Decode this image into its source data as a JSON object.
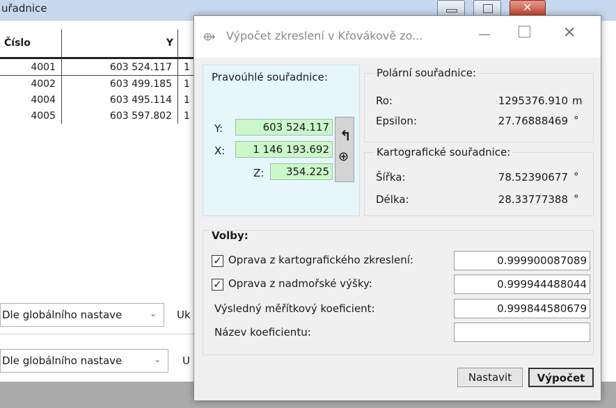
{
  "background_window": {
    "title": "uřadnice",
    "table": {
      "headers": [
        "Číslo",
        "Y",
        ""
      ],
      "rows": [
        [
          "4001",
          "603 524.117",
          "1"
        ],
        [
          "4002",
          "603 499.185",
          "1"
        ],
        [
          "4004",
          "603 495.114",
          "1"
        ],
        [
          "4005",
          "603 597.802",
          "1"
        ]
      ]
    },
    "combo1": {
      "value": "Dle globálního nastave",
      "side_label": "Uk"
    },
    "combo2": {
      "value": "Dle globálního nastave",
      "side_label": "U"
    }
  },
  "dialog": {
    "title": "Výpočet zkreslení v Křovákově zo...",
    "pravouhle": {
      "title": "Pravoúhlé souřadnice:",
      "y_label": "Y:",
      "y_value": "603 524.117",
      "x_label": "X:",
      "x_value": "1 146 193.692",
      "z_label": "Z:",
      "z_value": "354.225"
    },
    "polarni": {
      "title": "Polární souřadnice:",
      "ro_label": "Ro:",
      "ro_value": "1295376.910",
      "ro_unit": "m",
      "eps_label": "Epsilon:",
      "eps_value": "27.76888469",
      "eps_unit": "°"
    },
    "kartograficke": {
      "title": "Kartografické souřadnice:",
      "sirka_label": "Šířka:",
      "sirka_value": "78.52390677",
      "sirka_unit": "°",
      "delka_label": "Délka:",
      "delka_value": "28.33777388",
      "delka_unit": "°"
    },
    "volby": {
      "title": "Volby:",
      "opt1_label": "Oprava z kartografického zkreslení:",
      "opt1_checked": true,
      "opt1_value": "0.999900087089",
      "opt2_label": "Oprava z nadmořské výšky:",
      "opt2_checked": true,
      "opt2_value": "0.999944488044",
      "koef_label": "Výsledný měřítkový koeficient:",
      "koef_value": "0.999844580679",
      "nazev_label": "Název koeficientu:",
      "nazev_value": ""
    },
    "buttons": {
      "nastavit": "Nastavit",
      "vypocet": "Výpočet"
    }
  },
  "colors": {
    "green_field": "#cbf7cb",
    "pravouhle_panel": "#e6f7fb",
    "bg_titlebar": "#c7d9ee"
  }
}
